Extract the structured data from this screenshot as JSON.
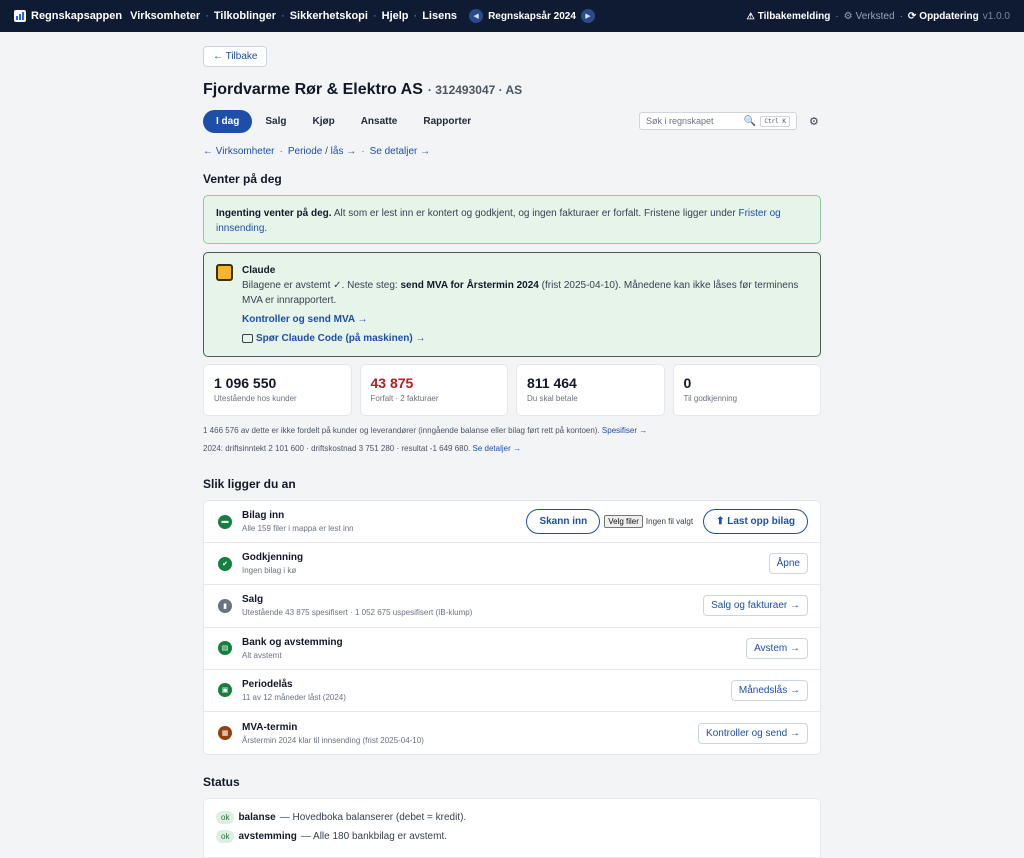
{
  "topnav": {
    "brand": "Regnskapsappen",
    "links": [
      "Virksomheter",
      "Tilkoblinger",
      "Sikkerhetskopi",
      "Hjelp",
      "Lisens"
    ],
    "year_label": "Regnskapsår 2024",
    "right": {
      "feedback": "Tilbakemelding",
      "workshop": "Verksted",
      "update": "Oppdatering",
      "version": "v1.0.0"
    }
  },
  "page": {
    "back_label": "← Tilbake",
    "company_name": "Fjordvarme Rør & Elektro AS",
    "company_sub": "· 312493047 · AS"
  },
  "tabs": [
    "I dag",
    "Salg",
    "Kjøp",
    "Ansatte",
    "Rapporter"
  ],
  "search": {
    "placeholder": "Søk i regnskapet",
    "shortcut": "Ctrl K"
  },
  "crumbs": [
    "← Virksomheter",
    "Periode / lås →",
    "Se detaljer →"
  ],
  "waiting": {
    "title": "Venter på deg",
    "alert_bold": "Ingenting venter på deg.",
    "alert_text": "Alt som er lest inn er kontert og godkjent, og ingen fakturaer er forfalt. Fristene ligger under",
    "alert_link": "Frister og innsending",
    "alert_end": "."
  },
  "claude": {
    "name": "Claude",
    "text_before": "Bilagene er avstemt ✓. Neste steg:",
    "text_bold": "send MVA for Årstermin 2024",
    "text_after": "(frist 2025-04-10). Månedene kan ikke låses før terminens MVA er innrapportert.",
    "link1": "Kontroller og send MVA →",
    "link2": "Spør Claude Code (på maskinen) →"
  },
  "stats": [
    {
      "value": "1 096 550",
      "label": "Utestående hos kunder",
      "color": "#111827"
    },
    {
      "value": "43 875",
      "label": "Forfalt · 2 fakturaer",
      "color": "#b91c1c"
    },
    {
      "value": "811 464",
      "label": "Du skal betale",
      "color": "#111827"
    },
    {
      "value": "0",
      "label": "Til godkjenning",
      "color": "#111827"
    }
  ],
  "notes": {
    "n1_text": "1 466 576 av dette er ikke fordelt på kunder og leverandører (inngående balanse eller bilag ført rett på kontoen).",
    "n1_link": "Spesifiser →",
    "n2_text": "2024: driftsinntekt 2 101 600 · driftskostnad 3 751 280 · resultat -1 649 680.",
    "n2_link": "Se detaljer →"
  },
  "overview": {
    "title": "Slik ligger du an",
    "rows": [
      {
        "title": "Bilag inn",
        "sub": "Alle 159 filer i mappa er lest inn",
        "icon": "inbox-icon"
      },
      {
        "title": "Godkjenning",
        "sub": "Ingen bilag i kø",
        "icon": "check-icon",
        "action": "Åpne"
      },
      {
        "title": "Salg",
        "sub": "Utestående 43 875 spesifisert · 1 052 675 uspesifisert (IB-klump)",
        "icon": "document-icon",
        "action": "Salg og fakturaer →"
      },
      {
        "title": "Bank og avstemming",
        "sub": "Alt avstemt",
        "icon": "bank-icon",
        "action": "Avstem →"
      },
      {
        "title": "Periodelås",
        "sub": "11 av 12 måneder låst (2024)",
        "icon": "lock-icon",
        "action": "Månedslås →"
      },
      {
        "title": "MVA-termin",
        "sub": "Årstermin 2024 klar til innsending (frist 2025-04-10)",
        "icon": "calendar-icon",
        "action": "Kontroller og send →"
      }
    ],
    "scan_label": "Skann inn",
    "file_button": "Velg filer",
    "file_status": "Ingen fil valgt",
    "upload_label": "⬆ Last opp bilag"
  },
  "status": {
    "title": "Status",
    "lines": [
      {
        "badge": "ok",
        "key": "balanse",
        "text": "— Hovedboka balanserer (debet = kredit)."
      },
      {
        "badge": "ok",
        "key": "avstemming",
        "text": "— Alle 180 bankbilag er avstemt."
      }
    ]
  },
  "colors": {
    "accent": "#1e4fa8",
    "nav_bg": "#0f1b33",
    "ok_bg": "#e6f4ea",
    "overdue": "#b91c1c"
  }
}
